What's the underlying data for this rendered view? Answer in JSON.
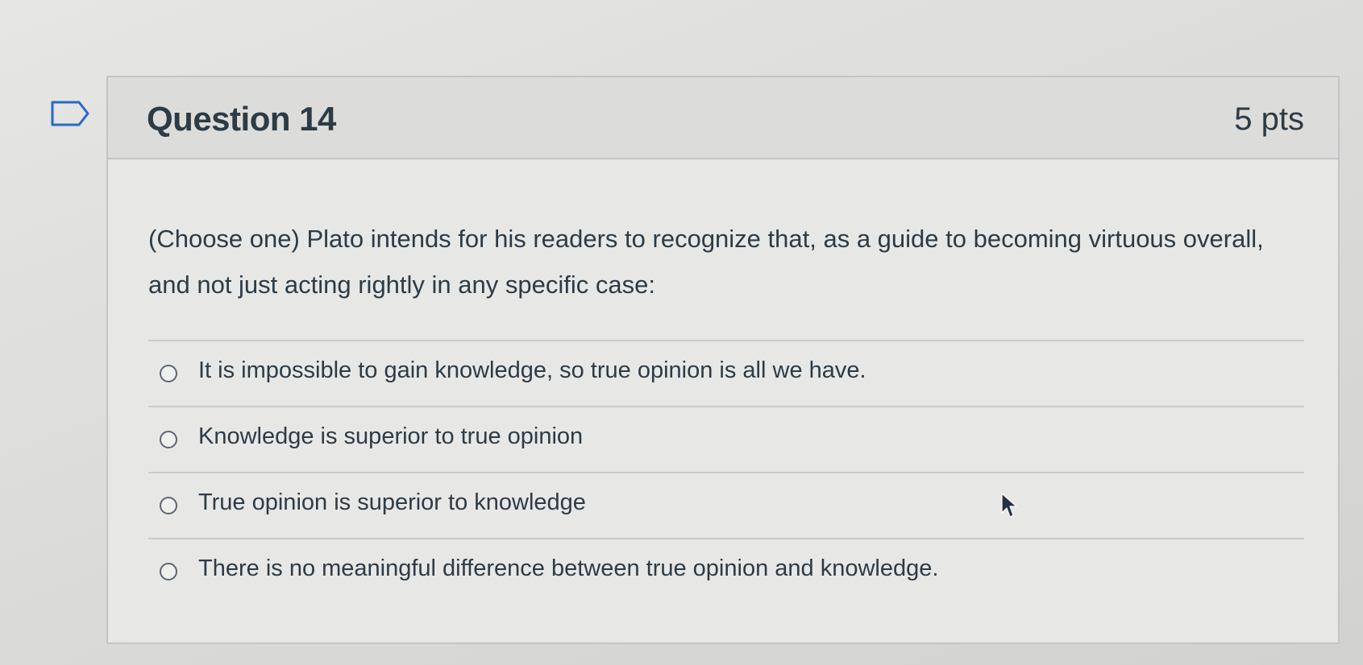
{
  "question": {
    "title": "Question 14",
    "points": "5 pts",
    "text": "(Choose one) Plato intends for his readers to recognize that, as a guide to becoming virtuous overall, and not just acting rightly in any specific case:"
  },
  "answers": [
    {
      "label": "It is impossible to gain knowledge, so true opinion is all we have.",
      "selected": false
    },
    {
      "label": "Knowledge is superior to true opinion",
      "selected": false
    },
    {
      "label": "True opinion is superior to knowledge",
      "selected": false
    },
    {
      "label": "There is no meaningful difference between true opinion and knowledge.",
      "selected": false
    }
  ],
  "icons": {
    "flag": "flag-question-icon",
    "cursor": "mouse-pointer-icon"
  },
  "colors": {
    "text": "#2d3b45",
    "border": "#c2c5c7",
    "header_bg": "#dcdddb",
    "card_bg": "#e7e8e6"
  }
}
